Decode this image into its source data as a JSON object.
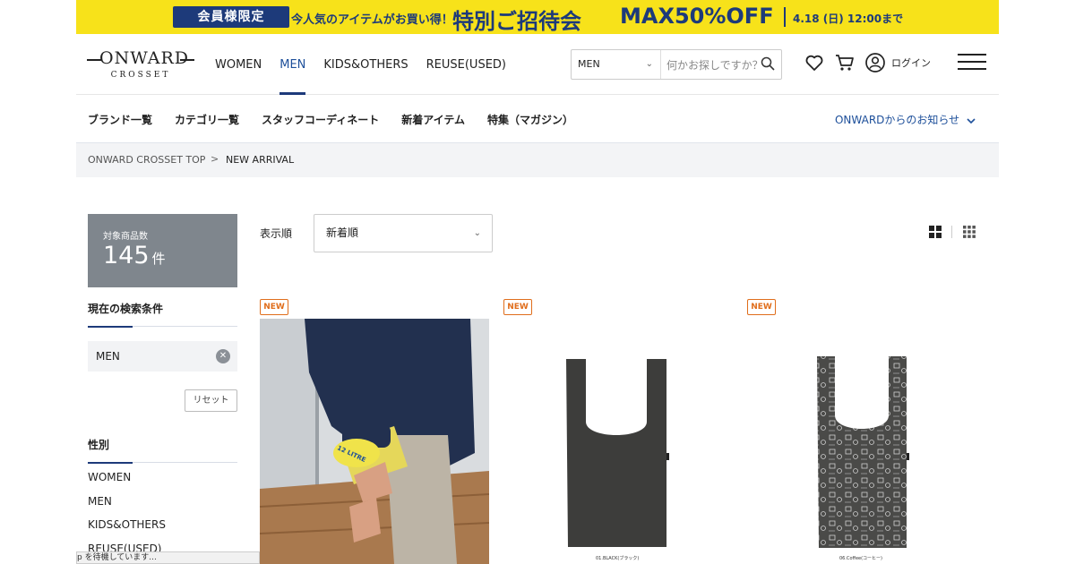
{
  "banner": {
    "pill": "会員様限定",
    "lead": "今人気のアイテムがお買い得！",
    "headline": "特別ご招待会",
    "max": "MAX50%OFF",
    "date": "4.18 (日) 12:00まで"
  },
  "logo": {
    "word": "ONWARD",
    "sub": "CROSSET"
  },
  "nav": {
    "items": [
      {
        "label": "WOMEN"
      },
      {
        "label": "MEN"
      },
      {
        "label": "KIDS&OTHERS"
      },
      {
        "label": "REUSE(USED)"
      }
    ]
  },
  "search": {
    "category": "MEN",
    "placeholder": "何かお探しですか？"
  },
  "header": {
    "login": "ログイン"
  },
  "subnav": {
    "links": [
      {
        "label": "ブランド一覧"
      },
      {
        "label": "カテゴリ一覧"
      },
      {
        "label": "スタッフコーディネート"
      },
      {
        "label": "新着アイテム"
      },
      {
        "label": "特集（マガジン）"
      }
    ],
    "notice": "ONWARDからのお知らせ"
  },
  "breadcrumb": {
    "top": "ONWARD CROSSET TOP",
    "current": "NEW ARRIVAL"
  },
  "sidebar": {
    "count_label": "対象商品数",
    "count": "145",
    "count_unit": "件",
    "conditions_heading": "現在の検索条件",
    "condition": "MEN",
    "reset": "リセット",
    "gender_heading": "性別",
    "gender_options": [
      "WOMEN",
      "MEN",
      "KIDS&OTHERS",
      "REUSE(USED)"
    ]
  },
  "sort": {
    "label": "表示順",
    "value": "新着順"
  },
  "products": [
    {
      "badge": "NEW",
      "image_text": "12 LITRE",
      "caption": ""
    },
    {
      "badge": "NEW",
      "caption": "01.BLACK(ブラック)"
    },
    {
      "badge": "NEW",
      "caption": "06.Coffee(コーヒー)"
    }
  ],
  "status_bar": "p を待機しています...",
  "colors": {
    "banner": "#f7e21a",
    "brand_navy": "#1d3a7a",
    "new_badge": "#e06e1c",
    "count_box": "#7f868d"
  }
}
